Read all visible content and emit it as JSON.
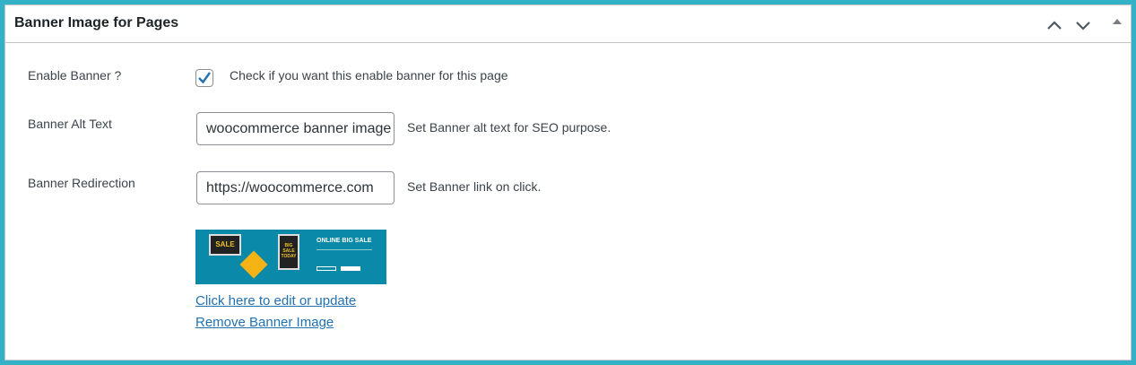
{
  "panel": {
    "title": "Banner Image for Pages"
  },
  "fields": {
    "enable": {
      "label": "Enable Banner ?",
      "checked": true,
      "description": "Check if you want this enable banner for this page"
    },
    "alt": {
      "label": "Banner Alt Text",
      "value": "woocommerce banner image",
      "description": "Set Banner alt text for SEO purpose."
    },
    "redirect": {
      "label": "Banner Redirection",
      "value": "https://woocommerce.com",
      "description": "Set Banner link on click."
    }
  },
  "banner": {
    "heading": "ONLINE BIG SALE",
    "sale": "SALE",
    "phone": "BIG SALE TODAY",
    "edit_link": "Click here to edit or update",
    "remove_link": "Remove Banner Image"
  },
  "colors": {
    "accent": "#2271b1",
    "border": "#33b1c6"
  }
}
